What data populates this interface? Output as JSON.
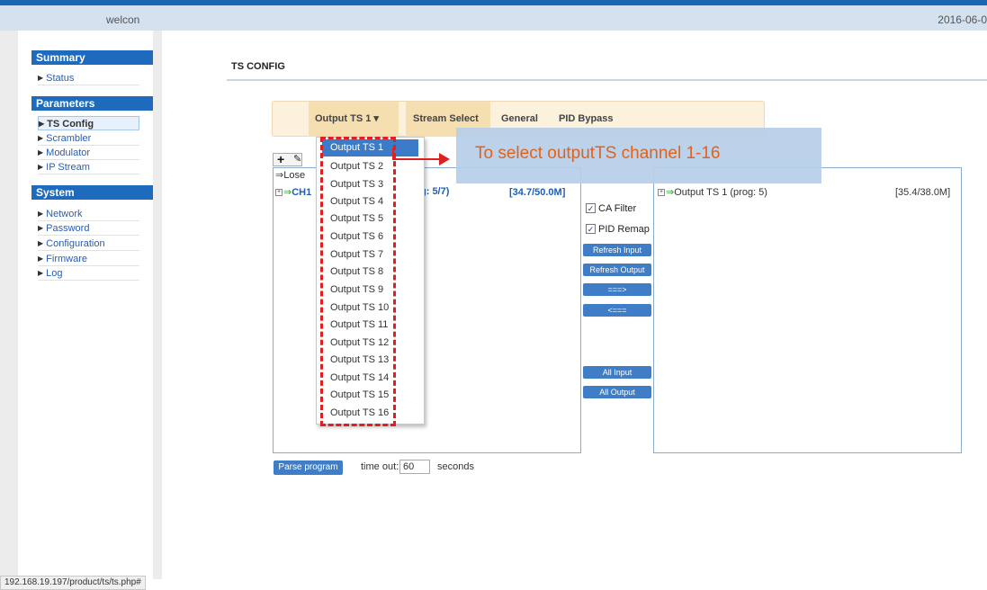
{
  "header": {
    "welcome": "welcon",
    "date": "2016-06-0"
  },
  "sidebar": {
    "sections": [
      {
        "title": "Summary",
        "items": [
          "Status"
        ]
      },
      {
        "title": "Parameters",
        "items": [
          "TS Config",
          "Scrambler",
          "Modulator",
          "IP Stream"
        ]
      },
      {
        "title": "System",
        "items": [
          "Network",
          "Password",
          "Configuration",
          "Firmware",
          "Log"
        ]
      }
    ],
    "active_item": "TS Config"
  },
  "page": {
    "title": "TS CONFIG"
  },
  "tabs": {
    "output_ts": "Output TS 1",
    "output_ts_caret": "▾",
    "stream_select": "Stream Select",
    "general": "General",
    "pid_bypass": "PID Bypass"
  },
  "dropdown": {
    "options": [
      "Output TS 1",
      "Output TS 2",
      "Output TS 3",
      "Output TS 4",
      "Output TS 5",
      "Output TS 6",
      "Output TS 7",
      "Output TS 8",
      "Output TS 9",
      "Output TS 10",
      "Output TS 11",
      "Output TS 12",
      "Output TS 13",
      "Output TS 14",
      "Output TS 15",
      "Output TS 16"
    ],
    "highlighted": "Output TS 1"
  },
  "input_panel": {
    "lose_label": "⇒Lose",
    "channel_prefix": "CH1",
    "prog_text": "rog: 5/7)",
    "rate": "[34.7/50.0M]"
  },
  "output_panel": {
    "tree_label": "Output TS 1 (prog: 5)",
    "rate": "[35.4/38.0M]"
  },
  "middle": {
    "ca_filter": {
      "label": "CA Filter",
      "checked": true
    },
    "pid_remap": {
      "label": "PID Remap",
      "checked": true
    },
    "refresh_input": "Refresh Input",
    "refresh_output": "Refresh Output",
    "move_right": "===>",
    "move_left": "<===",
    "all_input": "All Input",
    "all_output": "All Output"
  },
  "bottom": {
    "parse_button": "Parse program",
    "timeout_label": "time out:",
    "timeout_value": "60",
    "seconds_label": "seconds"
  },
  "annotation": {
    "text": "To select outputTS channel 1-16",
    "color": "#e0631c"
  },
  "statusbar": {
    "url": "192.168.19.197/product/ts/ts.php#"
  },
  "colors": {
    "accent": "#1e6bbd",
    "button": "#3f7dc6",
    "highlight_red": "#e02020"
  }
}
